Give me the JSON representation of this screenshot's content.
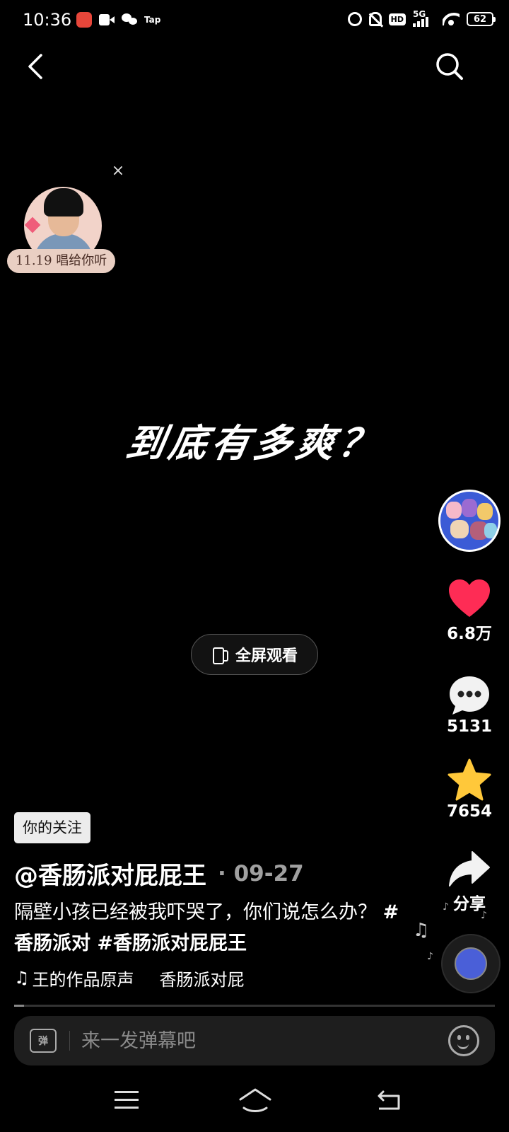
{
  "status_bar": {
    "time": "10:36",
    "tap_label": "Tap",
    "network": "5G",
    "battery": "62"
  },
  "promo": {
    "label": "11.19 唱给你听",
    "close_symbol": "×"
  },
  "video": {
    "overlay_text": "到底有多爽？",
    "fullscreen_label": "全屏观看"
  },
  "rail": {
    "likes": "6.8万",
    "comments": "5131",
    "favorites": "7654",
    "share_label": "分享",
    "colors": {
      "like": "#fe2c55",
      "star": "#ffc83a"
    }
  },
  "info": {
    "follow_badge": "你的关注",
    "author": "@香肠派对屁屁王",
    "date_sep": "·",
    "date": "09-27",
    "description": "隔壁小孩已经被我吓哭了，你们说怎么办？",
    "tags": "#香肠派对 #香肠派对屁屁王",
    "music_note": "♫",
    "music_title": "王的作品原声",
    "music_author": "香肠派对屁"
  },
  "progress": 0.02,
  "danmaku": {
    "toggle_label": "弹",
    "placeholder": "来一发弹幕吧"
  }
}
